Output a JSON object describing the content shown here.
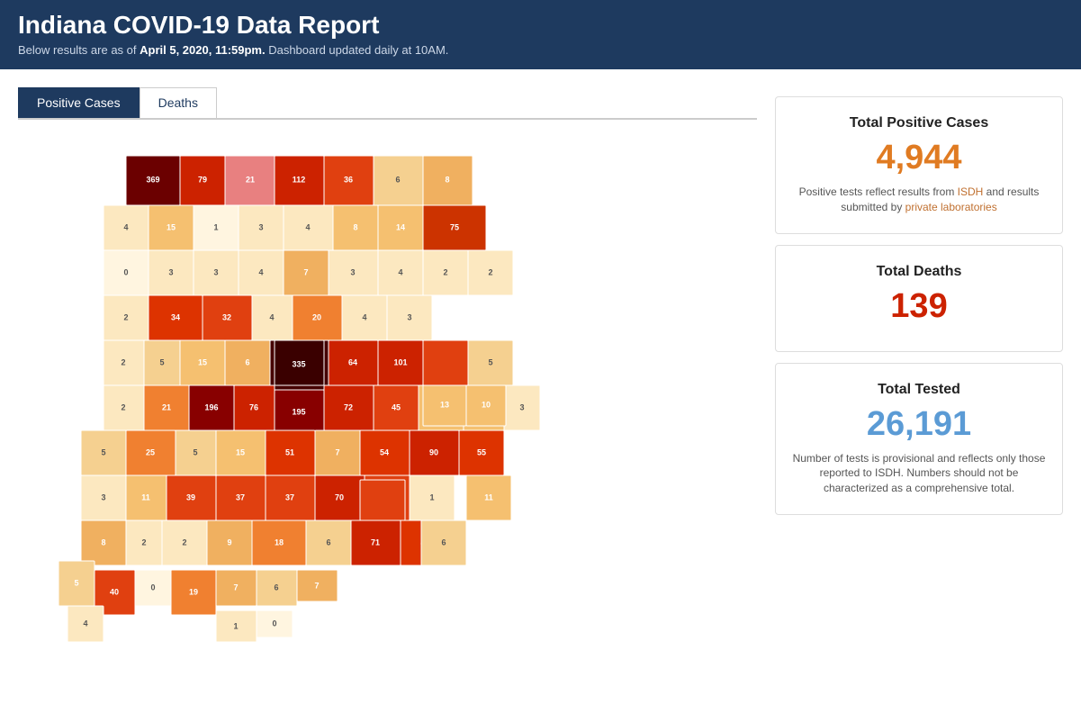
{
  "header": {
    "title": "Indiana COVID-19 Data Report",
    "subtitle_prefix": "Below results are as of ",
    "subtitle_bold": "April 5, 2020, 11:59pm.",
    "subtitle_suffix": " Dashboard updated daily at 10AM."
  },
  "tabs": [
    {
      "label": "Positive Cases",
      "active": true
    },
    {
      "label": "Deaths",
      "active": false
    }
  ],
  "stats": {
    "positive_cases": {
      "title": "Total Positive Cases",
      "value": "4,944",
      "note_part1": "Positive tests reflect results from ISDH and results submitted by private laboratories"
    },
    "deaths": {
      "title": "Total Deaths",
      "value": "139"
    },
    "tested": {
      "title": "Total Tested",
      "value": "26,191",
      "note": "Number of tests is provisional and reflects only those reported to ISDH. Numbers should not be characterized as a comprehensive total."
    }
  }
}
